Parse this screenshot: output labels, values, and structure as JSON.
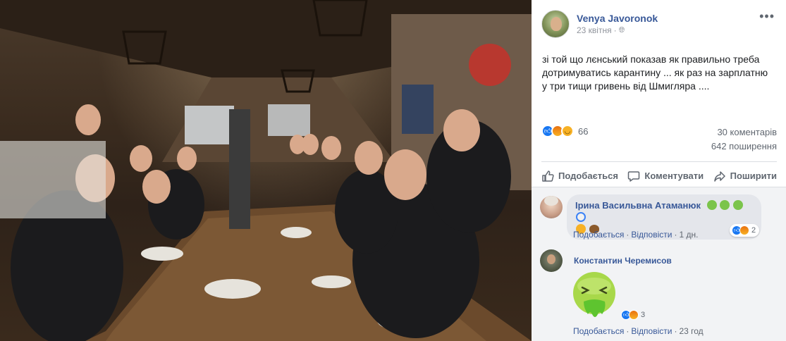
{
  "photo": {
    "description_icon": "group-photo-image"
  },
  "post": {
    "author": "Venya Javoronok",
    "date": "23 квітня",
    "privacy_icon": "globe-icon",
    "text": "зі той що лєнський показав як правильно треба дотримуватись карантину ... як раз на зарплатню у три тищи гривень від Шмигляра ....",
    "reactions_count": "66",
    "comments_count": "30 коментарів",
    "shares_count": "642 поширення"
  },
  "actions": {
    "like": "Подобається",
    "comment": "Коментувати",
    "share": "Поширити"
  },
  "comments": [
    {
      "author": "Ірина Васильвна Атаманюк",
      "reactions_count": "2",
      "like": "Подобається",
      "reply": "Відповісти",
      "time": "1 дн."
    },
    {
      "author": "Константин Черемисов",
      "reactions_count": "3",
      "like": "Подобається",
      "reply": "Відповісти",
      "time": "23 год"
    }
  ],
  "colors": {
    "link": "#385898",
    "meta": "#606770",
    "comments_bg": "#f2f3f5",
    "like_blue": "#1877f2"
  }
}
